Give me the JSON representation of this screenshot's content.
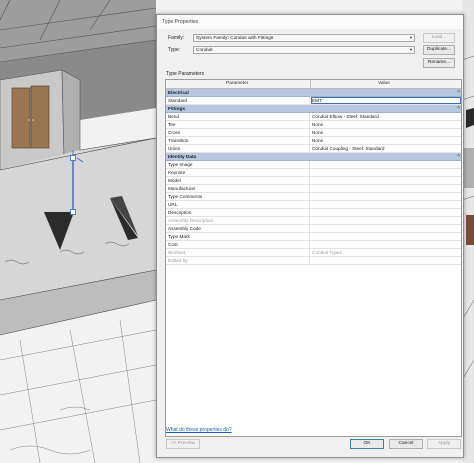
{
  "dialog": {
    "title": "Type Properties",
    "family_label": "Family:",
    "family_value": "System Family: Conduit with Fittings",
    "type_label": "Type:",
    "type_value": "Conduit",
    "load_btn": "Load...",
    "duplicate_btn": "Duplicate...",
    "rename_btn": "Rename...",
    "type_params_label": "Type Parameters",
    "col_parameter": "Parameter",
    "col_value": "Value",
    "help_link": "What do these properties do?",
    "preview_btn": "<< Preview",
    "ok_btn": "OK",
    "cancel_btn": "Cancel",
    "apply_btn": "Apply"
  },
  "rows": [
    {
      "kind": "group",
      "p": "Electrical",
      "v": ""
    },
    {
      "kind": "row",
      "p": "Standard",
      "v": "EMT",
      "edit": true
    },
    {
      "kind": "group",
      "p": "Fittings",
      "v": ""
    },
    {
      "kind": "row",
      "p": "Bend",
      "v": "Conduit Elbow - Steel: Standard"
    },
    {
      "kind": "row",
      "p": "Tee",
      "v": "None"
    },
    {
      "kind": "row",
      "p": "Cross",
      "v": "None"
    },
    {
      "kind": "row",
      "p": "Transition",
      "v": "None"
    },
    {
      "kind": "row",
      "p": "Union",
      "v": "Conduit Coupling - Steel: Standard"
    },
    {
      "kind": "group",
      "p": "Identity Data",
      "v": ""
    },
    {
      "kind": "row",
      "p": "Type Image",
      "v": ""
    },
    {
      "kind": "row",
      "p": "Keynote",
      "v": ""
    },
    {
      "kind": "row",
      "p": "Model",
      "v": ""
    },
    {
      "kind": "row",
      "p": "Manufacturer",
      "v": ""
    },
    {
      "kind": "row",
      "p": "Type Comments",
      "v": ""
    },
    {
      "kind": "row",
      "p": "URL",
      "v": ""
    },
    {
      "kind": "row",
      "p": "Description",
      "v": ""
    },
    {
      "kind": "dim",
      "p": "Assembly Description",
      "v": ""
    },
    {
      "kind": "row",
      "p": "Assembly Code",
      "v": ""
    },
    {
      "kind": "row",
      "p": "Type Mark",
      "v": ""
    },
    {
      "kind": "row",
      "p": "Cost",
      "v": ""
    },
    {
      "kind": "dim",
      "p": "Workset",
      "v": "Conduit Types"
    },
    {
      "kind": "dim",
      "p": "Edited by",
      "v": ""
    }
  ]
}
